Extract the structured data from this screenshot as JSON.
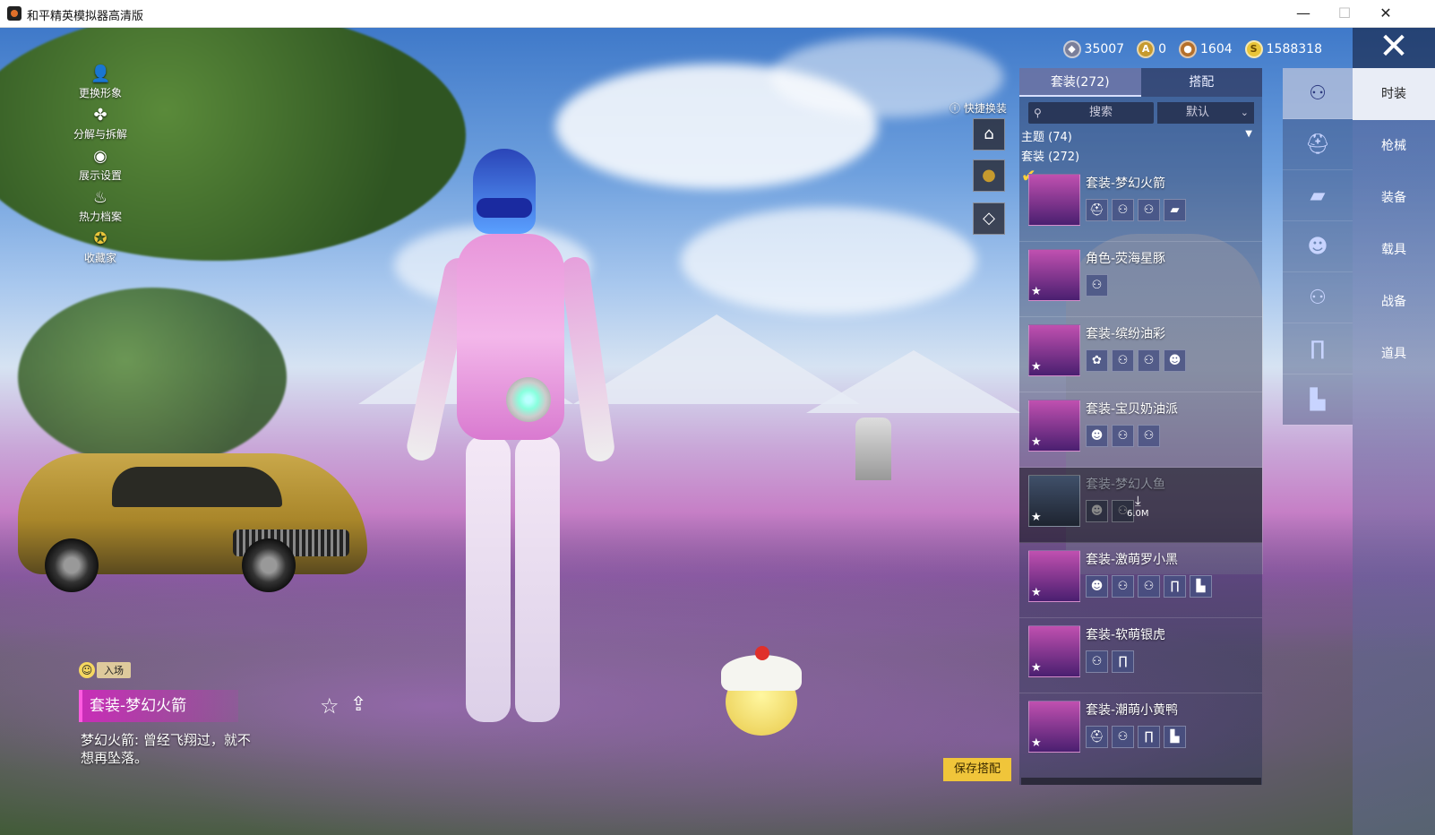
{
  "window": {
    "title": "和平精英模拟器高清版",
    "minimize": "—",
    "maximize": "☐",
    "close": "✕"
  },
  "left_menu": [
    {
      "label": "更换形象",
      "icon": "person-icon"
    },
    {
      "label": "分解与拆解",
      "icon": "puzzle-icon"
    },
    {
      "label": "展示设置",
      "icon": "eye-icon"
    },
    {
      "label": "热力档案",
      "icon": "flame-icon"
    },
    {
      "label": "收藏家",
      "icon": "collector-badge-icon"
    }
  ],
  "currency": [
    {
      "value": "35007",
      "icon": "silver-coin-icon",
      "color": "#7a7f9a",
      "glyph": "◆"
    },
    {
      "value": "0",
      "icon": "gold-badge-icon",
      "color": "#c69a2e",
      "glyph": "A"
    },
    {
      "value": "1604",
      "icon": "bronze-coin-icon",
      "color": "#b5702b",
      "glyph": "●"
    },
    {
      "value": "1588318",
      "icon": "gold-coin-icon",
      "color": "#e9c53a",
      "glyph": "S"
    }
  ],
  "close_panel": "✕",
  "categories": [
    {
      "label": "时装",
      "active": true
    },
    {
      "label": "枪械",
      "active": false
    },
    {
      "label": "装备",
      "active": false
    },
    {
      "label": "载具",
      "active": false
    },
    {
      "label": "战备",
      "active": false
    },
    {
      "label": "道具",
      "active": false
    }
  ],
  "icon_rail": [
    {
      "icon": "suit-icon",
      "glyph": "⚇",
      "active": true
    },
    {
      "icon": "headgear-icon",
      "glyph": "⛑",
      "active": false
    },
    {
      "icon": "glasses-icon",
      "glyph": "▰",
      "active": false
    },
    {
      "icon": "mask-icon",
      "glyph": "☻",
      "active": false
    },
    {
      "icon": "top-icon",
      "glyph": "⚇",
      "active": false
    },
    {
      "icon": "pants-icon",
      "glyph": "∏",
      "active": false
    },
    {
      "icon": "shoes-icon",
      "glyph": "▙",
      "active": false
    }
  ],
  "panel": {
    "tabs": [
      {
        "label": "套装(272)",
        "active": true
      },
      {
        "label": "搭配",
        "active": false
      }
    ],
    "search_placeholder": "搜索",
    "sort_label": "默认",
    "theme_label": "主题 (74)",
    "set_count_label": "套装 (272)",
    "items": [
      {
        "name": "套装-梦幻火箭",
        "parts": [
          "⛑",
          "⚇",
          "⚇",
          "▰"
        ],
        "selected": true,
        "dim": false,
        "star": false
      },
      {
        "name": "角色-荧海星豚",
        "parts": [
          "⚇"
        ],
        "selected": false,
        "dim": false,
        "star": true
      },
      {
        "name": "套装-缤纷油彩",
        "parts": [
          "✿",
          "⚇",
          "⚇",
          "☻"
        ],
        "selected": false,
        "dim": false,
        "star": true
      },
      {
        "name": "套装-宝贝奶油派",
        "parts": [
          "☻",
          "⚇",
          "⚇"
        ],
        "selected": false,
        "dim": false,
        "star": true
      },
      {
        "name": "套装-梦幻人鱼",
        "parts": [
          "☻",
          "⚇"
        ],
        "selected": false,
        "dim": true,
        "star": true,
        "download": "6.0M"
      },
      {
        "name": "套装-激萌罗小黑",
        "parts": [
          "☻",
          "⚇",
          "⚇",
          "∏",
          "▙"
        ],
        "selected": false,
        "dim": false,
        "star": true
      },
      {
        "name": "套装-软萌银虎",
        "parts": [
          "⚇",
          "∏"
        ],
        "selected": false,
        "dim": false,
        "star": true
      },
      {
        "name": "套装-潮萌小黄鸭",
        "parts": [
          "⛑",
          "⚇",
          "∏",
          "▙"
        ],
        "selected": false,
        "dim": false,
        "star": true
      }
    ]
  },
  "quick_change": {
    "label": "快捷换装",
    "buttons": [
      {
        "icon": "wardrobe-icon",
        "glyph": "⌂"
      },
      {
        "icon": "medal-icon",
        "glyph": "●"
      },
      {
        "icon": "diamond-icon",
        "glyph": "◇"
      }
    ]
  },
  "save_button": "保存搭配",
  "outfit_info": {
    "badge": "入场",
    "title": "套装-梦幻火箭",
    "favorite_icon": "☆",
    "share_icon": "⇪",
    "description": "梦幻火箭: 曾经飞翔过，就不想再坠落。"
  }
}
